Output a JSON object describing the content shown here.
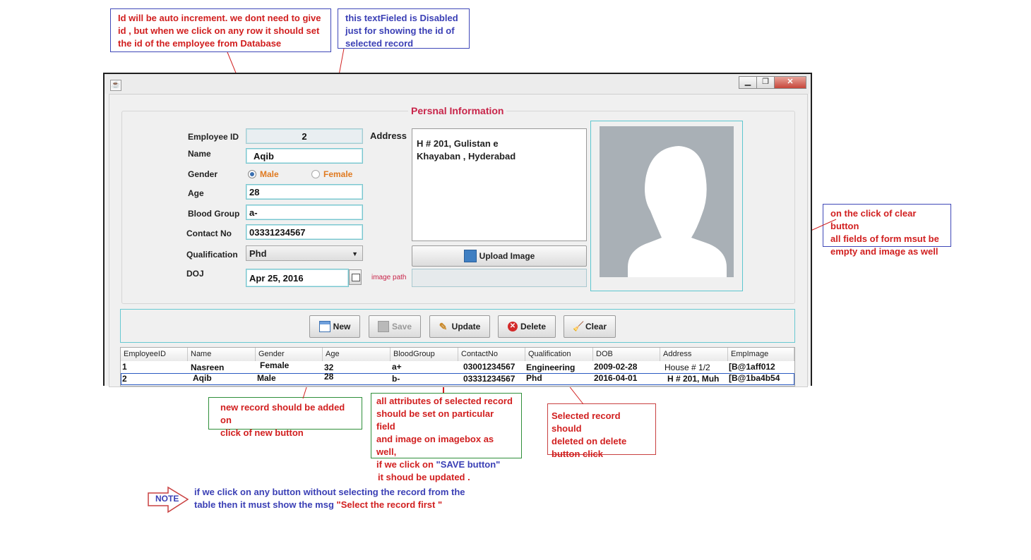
{
  "notes": {
    "autoincrement": "Id will be auto increment. we dont need to give\nid , but when we click on any row it should set\nthe id of the employee from Database",
    "disabled_field": "this textFieled is Disabled\njust for showing the id of\nselected record",
    "clear_button": "on the click of clear button\nall fields of form msut be\nempty and image as well",
    "new_record": "new record should be added on\nclick of new button",
    "update_line1": "all attributes of selected record\nshould be set on particular field\nand image on imagebox as well,\nif we click on ",
    "update_save": "\"SAVE button\"",
    "update_line2": "it shoud be updated .",
    "delete_record": "Selected record should\ndeleted on delete\nbutton click",
    "note_label": "NOTE",
    "note_text_1": "if we click on any button without selecting the record from the",
    "note_text_2": "table then it must show the msg ",
    "note_msg": "\"Select the record first \""
  },
  "window": {
    "title_buttons": {
      "minimize": "▁",
      "maximize": "❐",
      "close": "✕"
    },
    "panel_title": "Persnal Information",
    "form": {
      "employee_id_label": "Employee ID",
      "employee_id_value": "2",
      "name_label": "Name",
      "name_value": "Aqib",
      "gender_label": "Gender",
      "gender_male": "Male",
      "gender_female": "Female",
      "age_label": "Age",
      "age_value": "28",
      "blood_group_label": "Blood Group",
      "blood_group_value": "a-",
      "contact_label": "Contact No",
      "contact_value": "03331234567",
      "qualification_label": "Qualification",
      "qualification_value": "Phd",
      "doj_label": "DOJ",
      "doj_value": "Apr 25, 2016",
      "address_label": "Address",
      "address_value": "H # 201, Gulistan e\nKhayaban , Hyderabad",
      "upload_button": "Upload Image",
      "image_path_label": "image path",
      "image_path_value": ""
    },
    "buttons": {
      "new": "New",
      "save": "Save",
      "update": "Update",
      "delete": "Delete",
      "clear": "Clear"
    },
    "table": {
      "columns": [
        "EmployeeID",
        "Name",
        "Gender",
        "Age",
        "BloodGroup",
        "ContactNo",
        "Qualification",
        "DOB",
        "Address",
        "EmpImage"
      ],
      "rows": [
        [
          "1",
          "Nasreen",
          "Female",
          "32",
          "a+",
          "03001234567",
          "Engineering",
          "2009-02-28",
          "House # 1/2",
          "[B@1aff012"
        ],
        [
          "2",
          "Aqib",
          "Male",
          "28",
          "b-",
          "03331234567",
          "Phd",
          "2016-04-01",
          "H # 201, Muh",
          "[B@1ba4b54"
        ]
      ]
    }
  },
  "colors": {
    "annotation_red": "#d11f1f",
    "annotation_blue": "#3a3fb5",
    "panel_title": "#c8254a",
    "field_border": "#79c6cf",
    "gender_text": "#e07a20"
  }
}
